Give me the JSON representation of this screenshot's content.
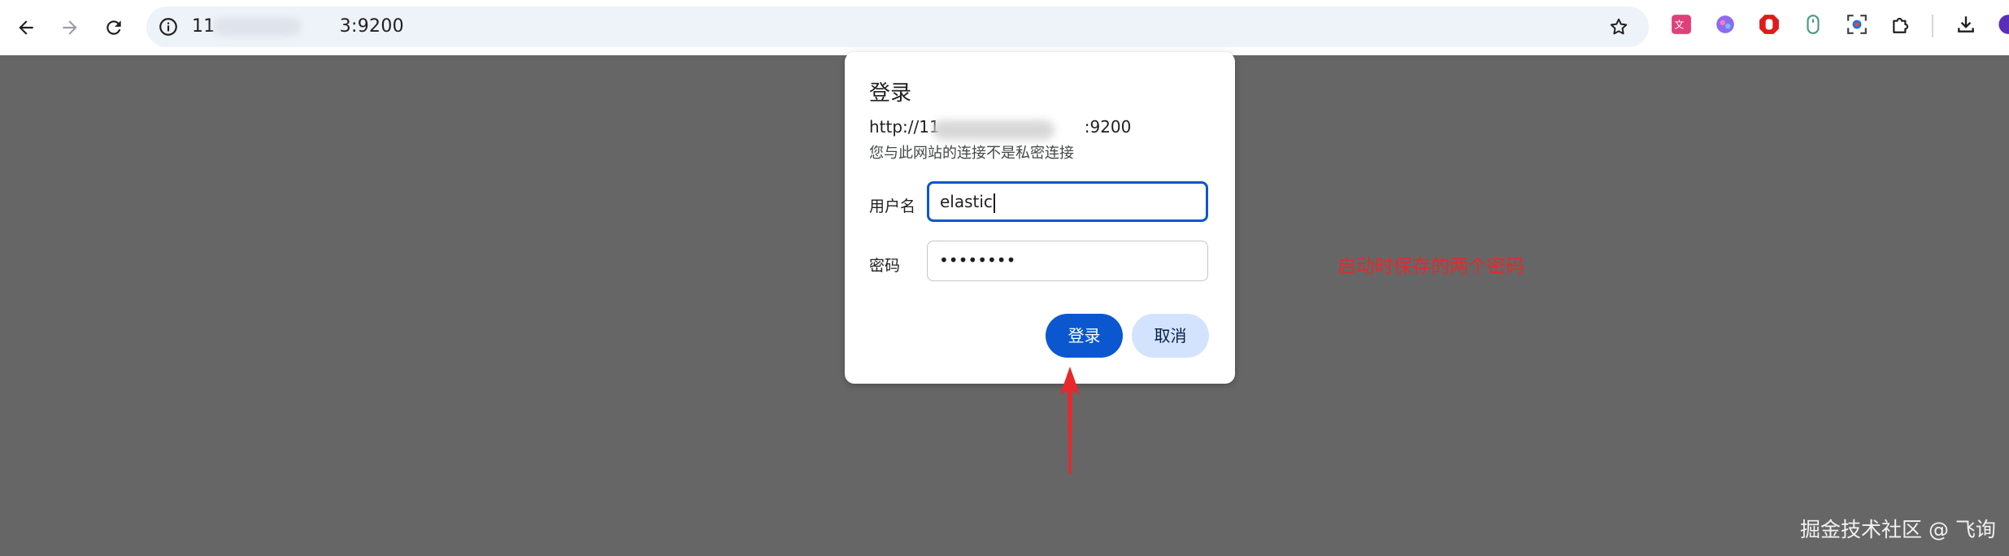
{
  "toolbar": {
    "url": "11                     3:9200",
    "icons": [
      "back-icon",
      "forward-icon",
      "reload-icon",
      "site-info-icon",
      "bookmark-star-icon",
      "translate-extension-icon",
      "ai-extension-icon",
      "adblock-extension-icon",
      "mouse-extension-icon",
      "capture-extension-icon",
      "extensions-puzzle-icon",
      "download-icon"
    ]
  },
  "dialog": {
    "title": "登录",
    "origin": "http://11                            :9200",
    "warning": "您与此网站的连接不是私密连接",
    "username_label": "用户名",
    "username_value": "elastic",
    "password_label": "密码",
    "password_value": "••••••••",
    "login_button": "登录",
    "cancel_button": "取消"
  },
  "annotation": {
    "text": "启动时保存的两个密码",
    "color": "#e8282b"
  },
  "watermark": "掘金技术社区 @ 飞询",
  "colors": {
    "accent": "#0b57d0",
    "overlay": "#666666",
    "secondary_button": "#d3e3fd"
  }
}
